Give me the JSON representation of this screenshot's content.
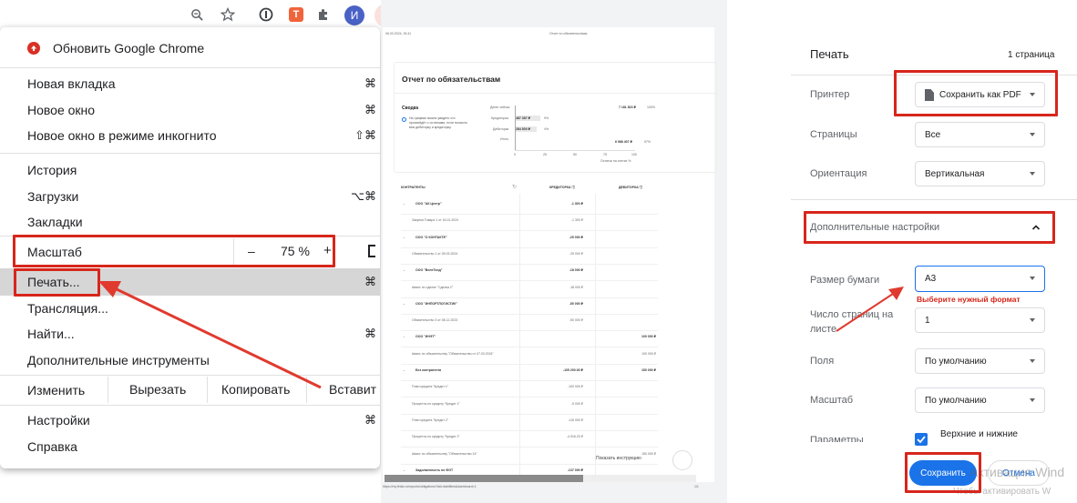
{
  "toolbar": {
    "avatar": "И"
  },
  "menu": {
    "update": "Обновить Google Chrome",
    "new_tab": "Новая вкладка",
    "new_tab_sc": "⌘",
    "new_window": "Новое окно",
    "new_window_sc": "⌘",
    "incognito": "Новое окно в режиме инкогнито",
    "incognito_sc": "⇧⌘",
    "history": "История",
    "downloads": "Загрузки",
    "downloads_sc": "⌥⌘",
    "bookmarks": "Закладки",
    "zoom": "Масштаб",
    "zoom_minus": "–",
    "zoom_value": "75 %",
    "zoom_plus": "+",
    "print": "Печать...",
    "print_sc": "⌘",
    "cast": "Трансляция...",
    "find": "Найти...",
    "find_sc": "⌘",
    "more_tools": "Дополнительные инструменты",
    "edit": "Изменить",
    "cut": "Вырезать",
    "copy": "Копировать",
    "paste": "Вставит",
    "settings": "Настройки",
    "settings_sc": "⌘",
    "help": "Справка"
  },
  "preview": {
    "header_date": "06.03.2024, 15:41",
    "header_title": "Отчет по обязательствам",
    "report_title": "Отчет по обязательствам",
    "summary": "Сводка",
    "summary_note": "На графике можно увидеть что произойдёт с остатками, если погасить всю дебиторку и кредиторку.",
    "cash_label": "Денег сейчас",
    "cash_value": "7 181 823 ₽",
    "pct": "100%",
    "kred_label": "Кредиторка",
    "kred_value": "487 387 ₽",
    "kred_pct": "9%",
    "deb_label": "Дебиторка",
    "deb_value": "284 800 ₽",
    "deb_pct": "4%",
    "total_label": "Итого",
    "total_value": "6 968 407 ₽",
    "total_pct": "97%",
    "chart_ticks": [
      "0",
      "25",
      "50",
      "75",
      "100"
    ],
    "chart_caption": "Остаток на счетах %",
    "col_counterparty": "КОНТРАГЕНТЫ",
    "col_kred": "КРЕДИТОРКА ⓘ",
    "col_deb": "ДЕБИТОРКА ⓘ",
    "rows": [
      {
        "name": "ООО \"АК Центр\"",
        "k": "-1 300 ₽",
        "d": "",
        "bold": true
      },
      {
        "name": "Закупка Товара 1 от 16.01.2024",
        "k": "-1 300 ₽",
        "d": "",
        "bold": false
      },
      {
        "name": "ООО \"О КОНТАКТЕ\"",
        "k": "-25 000 ₽",
        "d": "",
        "bold": true
      },
      {
        "name": "Обязательство 1 от 09.03.2024",
        "k": "-25 000 ₽",
        "d": "",
        "bold": false
      },
      {
        "name": "ООО \"ВелеТонд\"",
        "k": "-18 000 ₽",
        "d": "",
        "bold": true
      },
      {
        "name": "Аванс по сделке \"Сделка 2\"",
        "k": "-18 000 ₽",
        "d": "",
        "bold": false
      },
      {
        "name": "ООО \"ИНПОРТЛОГИСТИК\"",
        "k": "-50 000 ₽",
        "d": "",
        "bold": true
      },
      {
        "name": "Обязательство 3 от 08.12.2023",
        "k": "-50 000 ₽",
        "d": "",
        "bold": false
      },
      {
        "name": "ООО \"ИНЭТ\"",
        "k": "",
        "d": "100 000 ₽",
        "bold": true
      },
      {
        "name": "Аванс по обязательству \"Обязательство от 07.03.2024\"",
        "k": "",
        "d": "100 000 ₽",
        "bold": false
      },
      {
        "name": "Без контрагента",
        "k": "-105 200.00 ₽",
        "d": "150 000 ₽",
        "bold": true
      },
      {
        "name": "План кредита \"Кредит 1\"",
        "k": "-100 000 ₽",
        "d": "",
        "bold": false
      },
      {
        "name": "Проценты по кредиту \"Кредит 1\"",
        "k": "-5 000 ₽",
        "d": "",
        "bold": false
      },
      {
        "name": "План кредита \"Кредит 2\"",
        "k": "-115 000 ₽",
        "d": "",
        "bold": false
      },
      {
        "name": "Проценты по кредиту \"Кредит 2\"",
        "k": "-4 516.20 ₽",
        "d": "",
        "bold": false
      },
      {
        "name": "Аванс по обязательству \"Обязательство 14\"",
        "k": "",
        "d": "150 000 ₽",
        "bold": false
      },
      {
        "name": "Задолженность по ФОТ",
        "k": "-137 000 ₽",
        "d": "",
        "bold": true
      }
    ],
    "instructions": "Показать инструкцию",
    "footer_url": "https://my.finbiz.ru/reports/obligations?tab=liabilities&dashboard=1",
    "footer_page": "1/1"
  },
  "settings": {
    "title": "Печать",
    "pages_count": "1 страница",
    "printer_label": "Принтер",
    "printer_value": "Сохранить как PDF",
    "pages_label": "Страницы",
    "pages_value": "Все",
    "orient_label": "Ориентация",
    "orient_value": "Вертикальная",
    "more": "Дополнительные настройки",
    "paper_label": "Размер бумаги",
    "paper_value": "A3",
    "hint": "Выберите нужный формат",
    "per_sheet_label": "Число страниц на листе",
    "per_sheet_value": "1",
    "margins_label": "Поля",
    "margins_value": "По умолчанию",
    "scale_label": "Масштаб",
    "scale_value": "По умолчанию",
    "options_label": "Параметры",
    "headers_opt": "Верхние и нижние",
    "save": "Сохранить",
    "cancel": "Отмена",
    "watermark1": "Активация Wind",
    "watermark2": "Чтобы активировать W"
  },
  "colors": {
    "accent": "#1a73e8",
    "annotation_red": "#d7261b",
    "highlight": "#d6d6d6"
  }
}
